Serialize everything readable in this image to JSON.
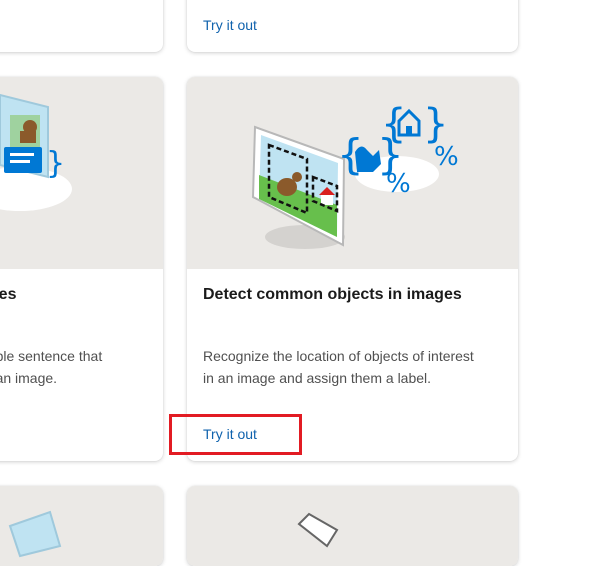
{
  "colors": {
    "link": "#0f62ad",
    "highlight": "#e21b23",
    "card_image_bg": "#ebe9e6",
    "accent_blue": "#0078d4"
  },
  "top_right_card": {
    "link_label": "Try it out"
  },
  "left_card": {
    "title_fragment": "ages",
    "desc_lines": [
      "dable sentence that",
      "of an image."
    ]
  },
  "main_card": {
    "illustration_icon": "object-detection-illustration",
    "title": "Detect common objects in images",
    "desc_lines": [
      "Recognize the location of objects of interest",
      "in an image and assign them a label."
    ],
    "link_label": "Try it out"
  }
}
